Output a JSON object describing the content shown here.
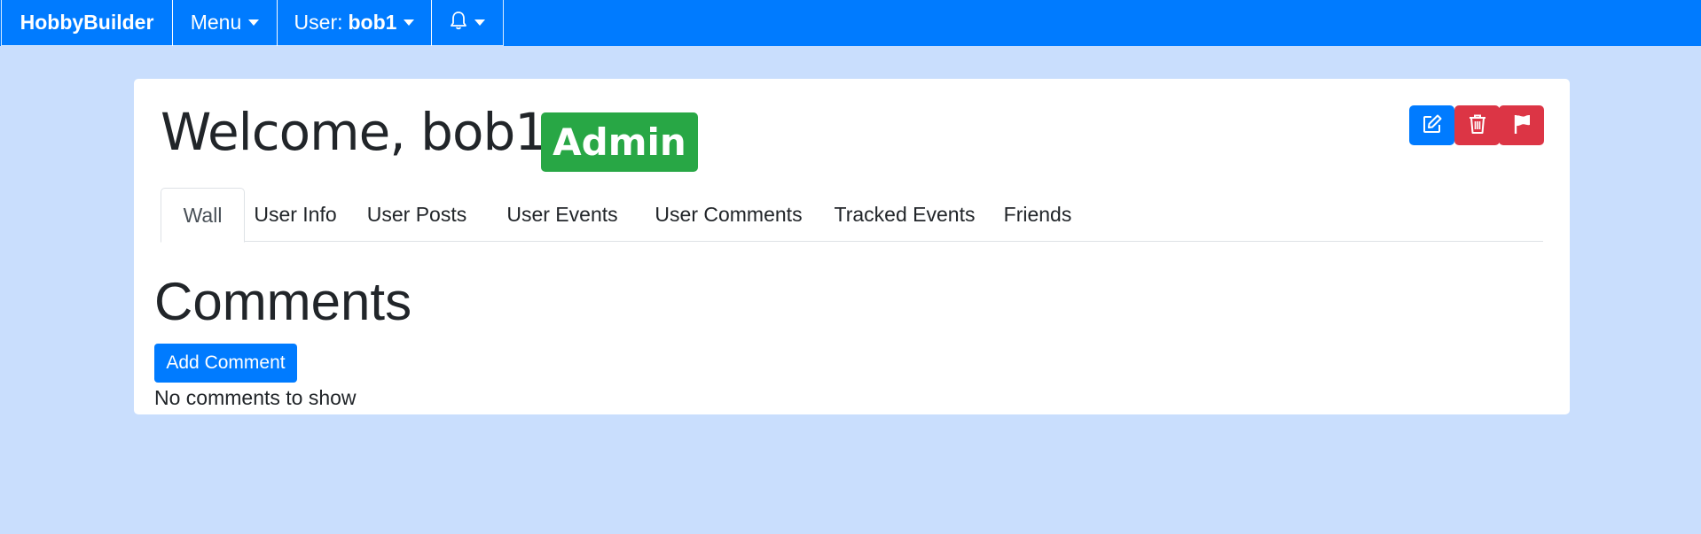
{
  "navbar": {
    "brand": "HobbyBuilder",
    "menu_label": "Menu",
    "user_prefix": "User:",
    "username": "bob1",
    "notifications_icon": "bell-icon"
  },
  "profile": {
    "welcome": "Welcome, bob1",
    "role_badge": "Admin",
    "actions": {
      "edit_icon": "pencil-square-icon",
      "delete_icon": "trash-icon",
      "report_icon": "flag-icon"
    }
  },
  "tabs": [
    {
      "label": "Wall",
      "active": true
    },
    {
      "label": "User Info",
      "active": false
    },
    {
      "label": "User Posts",
      "active": false
    },
    {
      "label": "User Events",
      "active": false
    },
    {
      "label": "User Comments",
      "active": false
    },
    {
      "label": "Tracked Events",
      "active": false
    },
    {
      "label": "Friends",
      "active": false
    }
  ],
  "comments": {
    "heading": "Comments",
    "add_button": "Add Comment",
    "empty_message": "No comments to show"
  },
  "colors": {
    "navbar": "#007bff",
    "page_background": "#c9defd",
    "admin_badge": "#28a745",
    "danger": "#dc3545",
    "primary": "#007bff"
  }
}
